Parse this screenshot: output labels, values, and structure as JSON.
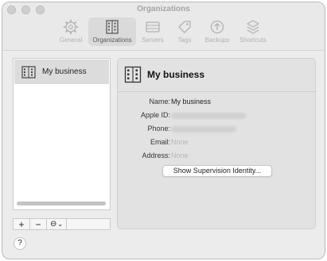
{
  "window": {
    "title": "Organizations"
  },
  "toolbar": {
    "items": [
      {
        "label": "General",
        "icon": "gear-icon"
      },
      {
        "label": "Organizations",
        "icon": "building-icon",
        "selected": true
      },
      {
        "label": "Servers",
        "icon": "server-icon"
      },
      {
        "label": "Tags",
        "icon": "tag-icon"
      },
      {
        "label": "Backups",
        "icon": "backup-icon"
      },
      {
        "label": "Shortcuts",
        "icon": "shortcuts-icon"
      }
    ]
  },
  "sidebar": {
    "items": [
      {
        "label": "My business",
        "icon": "building-icon",
        "selected": true
      }
    ],
    "buttons": {
      "add": "+",
      "remove": "−",
      "more": "⊖",
      "more_chevron": "⌄"
    }
  },
  "detail": {
    "title": "My business",
    "fields": [
      {
        "label": "Name:",
        "value": "My business"
      },
      {
        "label": "Apple ID:",
        "value": ""
      },
      {
        "label": "Phone:",
        "value": ""
      },
      {
        "label": "Email:",
        "value": "None"
      },
      {
        "label": "Address:",
        "value": "None"
      }
    ],
    "supervision_button": "Show Supervision Identity..."
  },
  "help": "?"
}
